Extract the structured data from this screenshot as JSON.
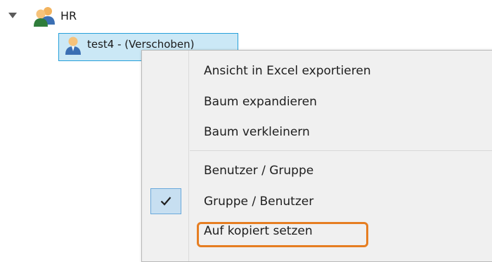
{
  "tree": {
    "root": {
      "label": "HR",
      "icon": "user-group-icon",
      "expanded": true
    },
    "child": {
      "label": "test4 - (Verschoben)",
      "icon": "user-icon",
      "selected": true
    }
  },
  "context_menu": {
    "items": [
      {
        "label": "Ansicht in Excel exportieren",
        "checked": false
      },
      {
        "label": "Baum expandieren",
        "checked": false
      },
      {
        "label": "Baum verkleinern",
        "checked": false
      },
      {
        "label": "Benutzer / Gruppe",
        "checked": false
      },
      {
        "label": "Gruppe / Benutzer",
        "checked": true
      },
      {
        "label": "Auf kopiert setzen",
        "checked": false,
        "highlighted": true
      }
    ]
  },
  "colors": {
    "selection_fill": "#cbe8f6",
    "selection_border": "#26a0da",
    "menu_background": "#f0f0f0",
    "highlight_outline": "#e67e22"
  }
}
